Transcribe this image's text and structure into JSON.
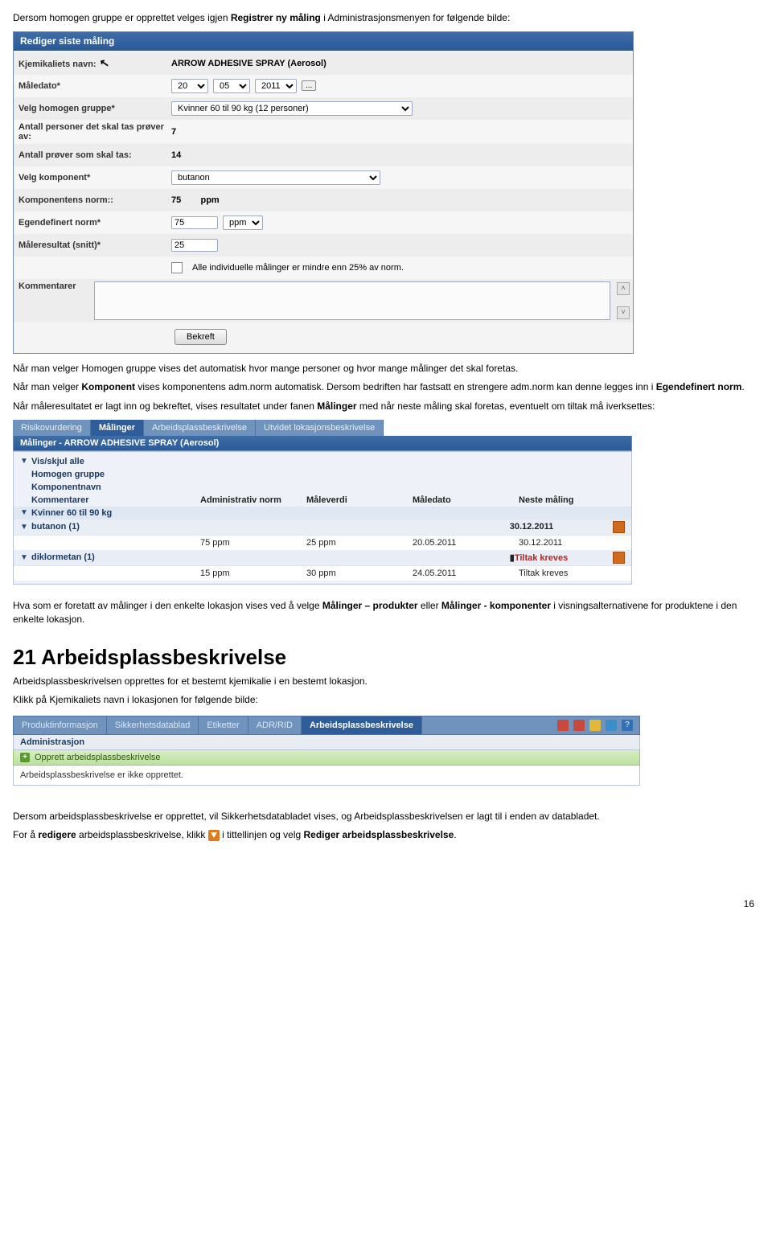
{
  "intro": {
    "p1a": "Dersom homogen gruppe er opprettet velges igjen ",
    "p1b": "Registrer ny måling",
    "p1c": " i Administrasjonsmenyen for følgende bilde:"
  },
  "editPanel": {
    "title": "Rediger siste måling",
    "rows": {
      "chemName": {
        "label": "Kjemikaliets navn:",
        "value": "ARROW ADHESIVE SPRAY (Aerosol)"
      },
      "date": {
        "label": "Måledato*",
        "d": "20",
        "m": "05",
        "y": "2011",
        "more": "..."
      },
      "group": {
        "label": "Velg homogen gruppe*",
        "value": "Kvinner 60 til 90 kg (12 personer)"
      },
      "persons": {
        "label": "Antall personer det skal tas prøver av:",
        "value": "7"
      },
      "samples": {
        "label": "Antall prøver som skal tas:",
        "value": "14"
      },
      "component": {
        "label": "Velg komponent*",
        "value": "butanon"
      },
      "compnorm": {
        "label": "Komponentens norm::",
        "value": "75",
        "unit": "ppm"
      },
      "ownnorm": {
        "label": "Egendefinert norm*",
        "value": "75",
        "unit": "ppm"
      },
      "result": {
        "label": "Måleresultat (snitt)*",
        "value": "25"
      },
      "check": {
        "label": "",
        "text": "Alle individuelle målinger er mindre enn 25% av norm."
      },
      "comments": {
        "label": "Kommentarer"
      }
    },
    "confirm": "Bekreft"
  },
  "followup": {
    "p2a": "Når man velger Homogen gruppe vises det automatisk hvor mange personer og hvor mange målinger det skal foretas.",
    "p2b_a": "Når man velger ",
    "p2b_b": "Komponent",
    "p2b_c": " vises komponentens adm.norm automatisk. Dersom bedriften har fastsatt en strengere adm.norm kan denne legges inn i ",
    "p2b_d": "Egendefinert norm",
    "p2b_e": ".",
    "p3a": "Når måleresultatet er lagt inn og bekreftet, vises resultatet under fanen ",
    "p3b": "Målinger",
    "p3c": " med når neste måling skal foretas, eventuelt om tiltak må iverksettes:"
  },
  "tabs": {
    "risk": "Risikovurdering",
    "meas": "Målinger",
    "desc": "Arbeidsplassbeskrivelse",
    "loc": "Utvidet lokasjonsbeskrivelse"
  },
  "measHeader": "Målinger - ARROW ADHESIVE SPRAY (Aerosol)",
  "listHeaders": {
    "vis": "Vis/skjul alle",
    "hg": "Homogen gruppe",
    "kn": "Komponentnavn",
    "km": "Kommentarer",
    "an": "Administrativ norm",
    "mv": "Måleverdi",
    "md": "Måledato",
    "nm": "Neste måling"
  },
  "groups": {
    "g1": "Kvinner 60 til 90 kg",
    "r1": {
      "name": "butanon (1)",
      "norm": "75 ppm",
      "val": "25 ppm",
      "date": "20.05.2011",
      "next": "30.12.2011",
      "nextSub": "30.12.2011"
    },
    "r2": {
      "name": "diklormetan (1)",
      "norm": "15 ppm",
      "val": "30 ppm",
      "date": "24.05.2011",
      "next": "Tiltak kreves",
      "nextSub": "Tiltak kreves"
    }
  },
  "mid": {
    "p4a": "Hva som er foretatt av målinger i den enkelte lokasjon vises ved å velge ",
    "p4b": "Målinger – produkter",
    "p4c": " eller ",
    "p4d": "Målinger - komponenter",
    "p4e": " i visningsalternativene for produktene i den enkelte lokasjon."
  },
  "section21": {
    "title": "21 Arbeidsplassbeskrivelse",
    "p5": "Arbeidsplassbeskrivelsen opprettes for et bestemt kjemikalie i en bestemt lokasjon.",
    "p6": "Klikk på Kjemikaliets navn i lokasjonen for følgende bilde:"
  },
  "navtabs": {
    "prod": "Produktinformasjon",
    "sds": "Sikkerhetsdatablad",
    "et": "Etiketter",
    "adr": "ADR/RID",
    "apb": "Arbeidsplassbeskrivelse"
  },
  "admin": {
    "hdr": "Administrasjon",
    "create": "Opprett arbeidsplassbeskrivelse",
    "none": "Arbeidsplassbeskrivelse er ikke opprettet."
  },
  "bottom": {
    "p7": "Dersom arbeidsplassbeskrivelse er opprettet, vil Sikkerhetsdatabladet vises, og Arbeidsplassbeskrivelsen er lagt til i enden av databladet.",
    "p8a": "For å ",
    "p8b": "redigere",
    "p8c": " arbeidsplassbeskrivelse, klikk ",
    "p8d": " i tittellinjen og velg ",
    "p8e": "Rediger arbeidsplassbeskrivelse",
    "p8f": "."
  },
  "page": "16",
  "help": "?"
}
